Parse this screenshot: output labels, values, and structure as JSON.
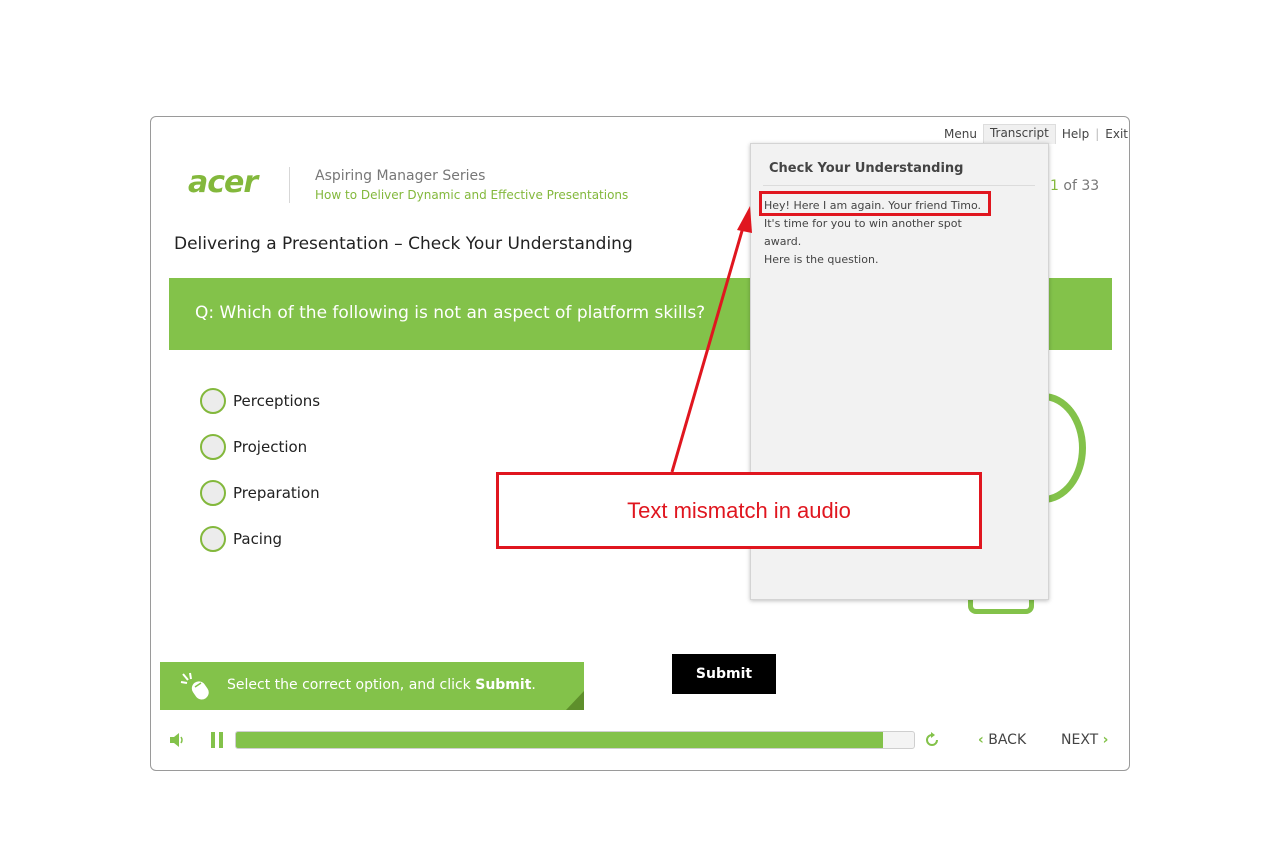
{
  "nav": {
    "menu": "Menu",
    "transcript": "Transcript",
    "help": "Help",
    "exit": "Exit",
    "separator": "|"
  },
  "header": {
    "logo": "acer",
    "series": "Aspiring Manager Series",
    "course": "How to Deliver Dynamic and Effective Presentations",
    "page_current": "1",
    "page_of": " of 33"
  },
  "slide": {
    "title": "Delivering a Presentation – Check Your Understanding",
    "question": "Q: Which of the following is not an aspect of platform skills?",
    "options": [
      "Perceptions",
      "Projection",
      "Preparation",
      "Pacing"
    ]
  },
  "transcript": {
    "title": "Check Your Understanding",
    "lines": [
      "Hey! Here I am again. Your friend Timo.",
      "It's time for you to win another spot award.",
      "Here is the question."
    ]
  },
  "instruction": {
    "prefix": "Select the correct option, and click ",
    "emphasis": "Submit",
    "suffix": "."
  },
  "submit_label": "Submit",
  "player": {
    "progress_fraction": 0.955,
    "back_label": "BACK",
    "next_label": "NEXT"
  },
  "annotation": {
    "callout": "Text mismatch in audio"
  },
  "colors": {
    "accent_green": "#83c24a",
    "annotation_red": "#e0161f"
  },
  "icons": {
    "volume": "volume-icon",
    "pause": "pause-icon",
    "replay": "replay-icon",
    "mouse": "mouse-click-icon",
    "back": "chevron-left-icon",
    "next": "chevron-right-icon"
  }
}
